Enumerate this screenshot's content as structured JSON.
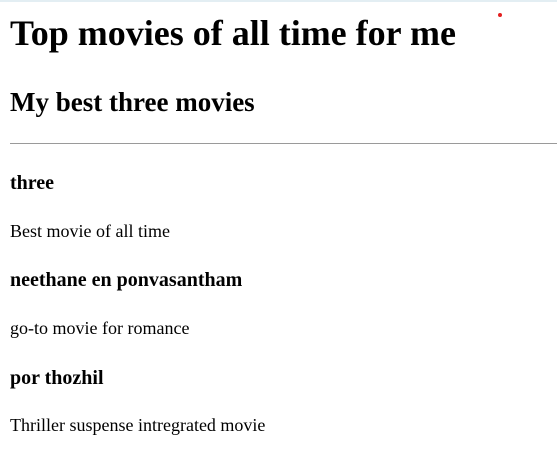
{
  "page": {
    "title": "Top movies of all time for me",
    "subtitle": "My best three movies"
  },
  "movies": [
    {
      "name": "three",
      "description": "Best movie of all time"
    },
    {
      "name": "neethane en ponvasantham",
      "description": "go-to movie for romance"
    },
    {
      "name": "por thozhil",
      "description": "Thriller suspense intregrated movie"
    }
  ],
  "colors": {
    "text": "#000000",
    "background": "#ffffff",
    "divider": "#9a9a9a",
    "indicator_dot": "#e32020"
  }
}
